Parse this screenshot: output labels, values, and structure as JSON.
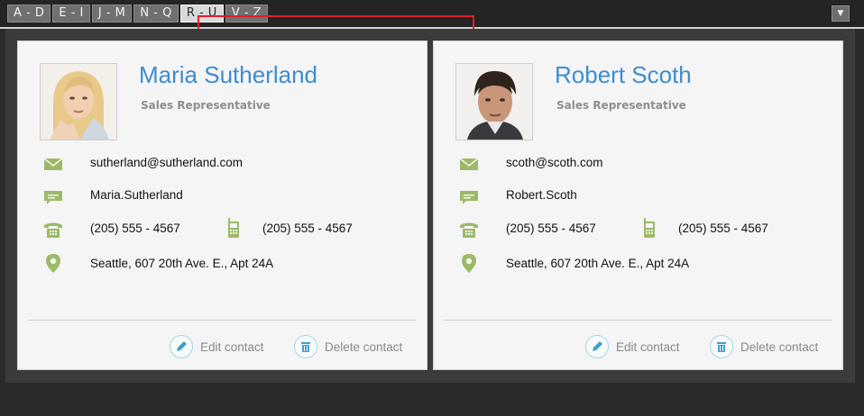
{
  "tabs": [
    {
      "label": "A - D",
      "active": false
    },
    {
      "label": "E - I",
      "active": false
    },
    {
      "label": "J - M",
      "active": false
    },
    {
      "label": "N - Q",
      "active": false
    },
    {
      "label": "R - U",
      "active": true
    },
    {
      "label": "V - Z",
      "active": false
    }
  ],
  "menu_button_glyph": "▼",
  "colors": {
    "accent": "#3d8ccf",
    "icon_green": "#9cba67",
    "highlight": "#e0202a"
  },
  "contacts": [
    {
      "name": "Maria Sutherland",
      "title": "Sales Representative",
      "email": "sutherland@sutherland.com",
      "messenger": "Maria.Sutherland",
      "phone": "(205) 555 - 4567",
      "mobile": "(205) 555 - 4567",
      "address": "Seattle, 607 20th Ave. E., Apt 24A",
      "edit_label": "Edit contact",
      "delete_label": "Delete contact"
    },
    {
      "name": "Robert Scoth",
      "title": "Sales Representative",
      "email": "scoth@scoth.com",
      "messenger": "Robert.Scoth",
      "phone": "(205) 555 - 4567",
      "mobile": "(205) 555 - 4567",
      "address": "Seattle, 607 20th Ave. E., Apt 24A",
      "edit_label": "Edit contact",
      "delete_label": "Delete contact"
    }
  ]
}
